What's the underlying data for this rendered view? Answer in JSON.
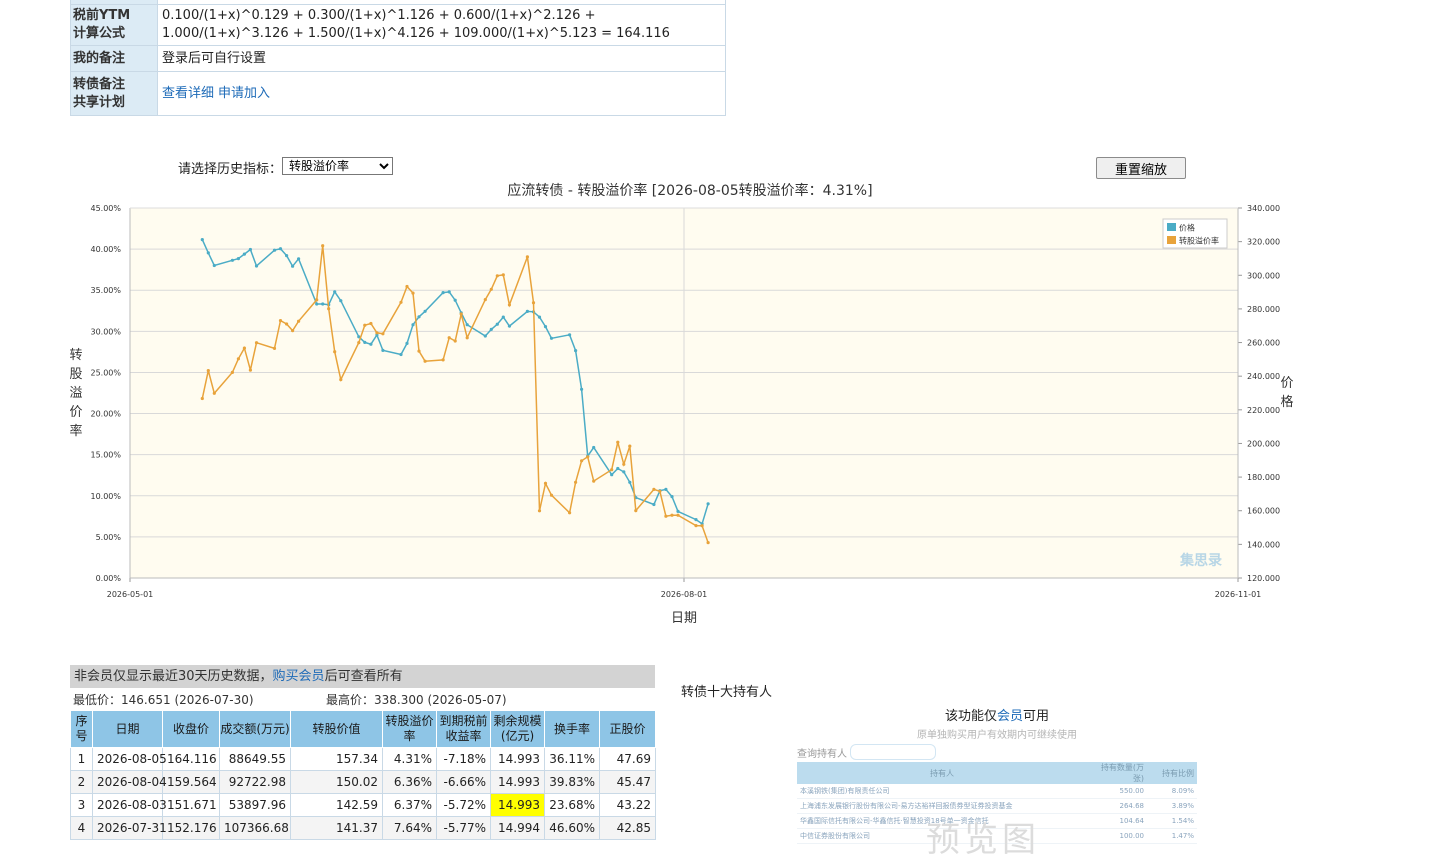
{
  "info": {
    "rows": [
      {
        "key_line1": "税前YTM",
        "key_line2": "计算公式",
        "value": "0.100/(1+x)^0.129 + 0.300/(1+x)^1.126 + 0.600/(1+x)^2.126 + 1.000/(1+x)^3.126 + 1.500/(1+x)^4.126 + 109.000/(1+x)^5.123 = 164.116"
      },
      {
        "key": "我的备注",
        "value": "登录后可自行设置"
      },
      {
        "key_line1": "转债备注",
        "key_line2": "共享计划",
        "link1": "查看详细",
        "link2": "申请加入"
      }
    ]
  },
  "controls": {
    "select_label": "请选择历史指标：",
    "select_value": "转股溢价率",
    "reset_label": "重置缩放"
  },
  "chart_data": {
    "type": "line",
    "title": "应流转债 - 转股溢价率 [2026-08-05转股溢价率：4.31%]",
    "xlabel": "日期",
    "ylabel_left": "转股溢价率",
    "ylabel_right": "价格",
    "x_range": [
      "2026-05-01",
      "2026-11-01"
    ],
    "x_ticks": [
      "2026-05-01",
      "2026-08-01",
      "2026-11-01"
    ],
    "y_left_range": [
      0,
      45
    ],
    "y_left_ticks": [
      "0.00%",
      "5.00%",
      "10.00%",
      "15.00%",
      "20.00%",
      "25.00%",
      "30.00%",
      "35.00%",
      "40.00%",
      "45.00%"
    ],
    "y_right_range": [
      120,
      340
    ],
    "y_right_ticks": [
      "120.000",
      "140.000",
      "160.000",
      "180.000",
      "200.000",
      "220.000",
      "240.000",
      "260.000",
      "280.000",
      "300.000",
      "320.000",
      "340.000"
    ],
    "grid": true,
    "legend_position": "top-right",
    "watermark": "集思录",
    "series": [
      {
        "name": "价格",
        "axis": "right",
        "color": "#4bacc6",
        "points": [
          [
            "2026-05-13",
            321.2
          ],
          [
            "2026-05-14",
            313.3
          ],
          [
            "2026-05-15",
            305.8
          ],
          [
            "2026-05-18",
            308.9
          ],
          [
            "2026-05-19",
            309.9
          ],
          [
            "2026-05-20",
            312.6
          ],
          [
            "2026-05-21",
            315.3
          ],
          [
            "2026-05-22",
            305.5
          ],
          [
            "2026-05-25",
            314.9
          ],
          [
            "2026-05-26",
            315.8
          ],
          [
            "2026-05-27",
            311.7
          ],
          [
            "2026-05-28",
            305.4
          ],
          [
            "2026-05-29",
            309.8
          ],
          [
            "2026-06-01",
            282.9
          ],
          [
            "2026-06-02",
            282.9
          ],
          [
            "2026-06-03",
            282.5
          ],
          [
            "2026-06-04",
            290.2
          ],
          [
            "2026-06-05",
            284.9
          ],
          [
            "2026-06-08",
            263.4
          ],
          [
            "2026-06-09",
            260.1
          ],
          [
            "2026-06-10",
            259.0
          ],
          [
            "2026-06-11",
            264.5
          ],
          [
            "2026-06-12",
            255.3
          ],
          [
            "2026-06-15",
            252.9
          ],
          [
            "2026-06-16",
            259.5
          ],
          [
            "2026-06-17",
            270.6
          ],
          [
            "2026-06-18",
            275.3
          ],
          [
            "2026-06-19",
            278.6
          ],
          [
            "2026-06-22",
            289.7
          ],
          [
            "2026-06-23",
            290.1
          ],
          [
            "2026-06-24",
            285.2
          ],
          [
            "2026-06-25",
            277.7
          ],
          [
            "2026-06-26",
            270.6
          ],
          [
            "2026-06-29",
            263.9
          ],
          [
            "2026-06-30",
            267.8
          ],
          [
            "2026-07-01",
            270.9
          ],
          [
            "2026-07-02",
            275.1
          ],
          [
            "2026-07-03",
            269.8
          ],
          [
            "2026-07-06",
            278.5
          ],
          [
            "2026-07-07",
            278.3
          ],
          [
            "2026-07-08",
            275.1
          ],
          [
            "2026-07-09",
            269.5
          ],
          [
            "2026-07-10",
            262.5
          ],
          [
            "2026-07-13",
            264.6
          ],
          [
            "2026-07-14",
            255.2
          ],
          [
            "2026-07-15",
            232.2
          ],
          [
            "2026-07-16",
            192.5
          ],
          [
            "2026-07-17",
            197.6
          ],
          [
            "2026-07-20",
            181.4
          ],
          [
            "2026-07-21",
            185.1
          ],
          [
            "2026-07-22",
            183.1
          ],
          [
            "2026-07-23",
            176.9
          ],
          [
            "2026-07-24",
            167.8
          ],
          [
            "2026-07-27",
            163.7
          ],
          [
            "2026-07-28",
            171.9
          ],
          [
            "2026-07-29",
            172.7
          ],
          [
            "2026-07-30",
            168.4
          ],
          [
            "2026-07-31",
            159.6
          ],
          [
            "2026-08-03",
            154.7
          ],
          [
            "2026-08-04",
            152.2
          ],
          [
            "2026-08-05",
            164.1
          ]
        ]
      },
      {
        "name": "转股溢价率",
        "axis": "left",
        "color": "#e8a33b",
        "points": [
          [
            "2026-05-13",
            21.83
          ],
          [
            "2026-05-14",
            25.23
          ],
          [
            "2026-05-15",
            22.46
          ],
          [
            "2026-05-18",
            25.01
          ],
          [
            "2026-05-19",
            26.66
          ],
          [
            "2026-05-20",
            27.96
          ],
          [
            "2026-05-21",
            25.29
          ],
          [
            "2026-05-22",
            28.62
          ],
          [
            "2026-05-25",
            27.92
          ],
          [
            "2026-05-26",
            31.3
          ],
          [
            "2026-05-27",
            30.89
          ],
          [
            "2026-05-28",
            30.09
          ],
          [
            "2026-05-29",
            31.23
          ],
          [
            "2026-06-01",
            33.82
          ],
          [
            "2026-06-02",
            40.42
          ],
          [
            "2026-06-03",
            32.75
          ],
          [
            "2026-06-04",
            27.52
          ],
          [
            "2026-06-05",
            24.13
          ],
          [
            "2026-06-08",
            28.63
          ],
          [
            "2026-06-09",
            30.75
          ],
          [
            "2026-06-10",
            30.95
          ],
          [
            "2026-06-11",
            29.82
          ],
          [
            "2026-06-12",
            29.7
          ],
          [
            "2026-06-15",
            33.53
          ],
          [
            "2026-06-16",
            35.45
          ],
          [
            "2026-06-17",
            34.65
          ],
          [
            "2026-06-18",
            27.59
          ],
          [
            "2026-06-19",
            26.37
          ],
          [
            "2026-06-22",
            26.52
          ],
          [
            "2026-06-23",
            29.23
          ],
          [
            "2026-06-24",
            28.83
          ],
          [
            "2026-06-25",
            32.11
          ],
          [
            "2026-06-26",
            29.22
          ],
          [
            "2026-06-29",
            33.86
          ],
          [
            "2026-06-30",
            35.11
          ],
          [
            "2026-07-01",
            36.75
          ],
          [
            "2026-07-02",
            36.86
          ],
          [
            "2026-07-03",
            33.22
          ],
          [
            "2026-07-06",
            39.05
          ],
          [
            "2026-07-07",
            33.48
          ],
          [
            "2026-07-08",
            8.17
          ],
          [
            "2026-07-09",
            11.5
          ],
          [
            "2026-07-10",
            10.07
          ],
          [
            "2026-07-13",
            7.93
          ],
          [
            "2026-07-14",
            11.64
          ],
          [
            "2026-07-15",
            14.25
          ],
          [
            "2026-07-16",
            14.74
          ],
          [
            "2026-07-17",
            11.79
          ],
          [
            "2026-07-20",
            13.17
          ],
          [
            "2026-07-21",
            16.52
          ],
          [
            "2026-07-22",
            13.83
          ],
          [
            "2026-07-23",
            16.04
          ],
          [
            "2026-07-24",
            8.2
          ],
          [
            "2026-07-27",
            10.78
          ],
          [
            "2026-07-28",
            10.54
          ],
          [
            "2026-07-29",
            7.52
          ],
          [
            "2026-07-30",
            7.64
          ],
          [
            "2026-07-31",
            7.64
          ],
          [
            "2026-08-03",
            6.37
          ],
          [
            "2026-08-04",
            6.36
          ],
          [
            "2026-08-05",
            4.31
          ]
        ]
      }
    ]
  },
  "history": {
    "notice_prefix": "非会员仅显示最近30天历史数据，",
    "notice_link": "购买会员",
    "notice_suffix": "后可查看所有",
    "low": "最低价：146.651 (2026-07-30)",
    "high": "最高价：338.300 (2026-05-07)",
    "headers": [
      "序号",
      "日期",
      "收盘价",
      "成交额(万元)",
      "转股价值",
      "转股溢价率",
      "到期税前收益率",
      "剩余规模(亿元)",
      "换手率",
      "正股价"
    ],
    "rows": [
      [
        "1",
        "2026-08-05",
        "164.116",
        "88649.55",
        "157.34",
        "4.31%",
        "-7.18%",
        "14.993",
        "36.11%",
        "47.69"
      ],
      [
        "2",
        "2026-08-04",
        "159.564",
        "92722.98",
        "150.02",
        "6.36%",
        "-6.66%",
        "14.993",
        "39.83%",
        "45.47"
      ],
      [
        "3",
        "2026-08-03",
        "151.671",
        "53897.96",
        "142.59",
        "6.37%",
        "-5.72%",
        "14.993",
        "23.68%",
        "43.22"
      ],
      [
        "4",
        "2026-07-31",
        "152.176",
        "107366.68",
        "141.37",
        "7.64%",
        "-5.77%",
        "14.994",
        "46.60%",
        "42.85"
      ]
    ]
  },
  "holders": {
    "title": "转债十大持有人",
    "locked_prefix": "该功能仅",
    "locked_link": "会员",
    "locked_suffix": "可用",
    "locked_sub": "原单独购买用户有效期内可继续使用",
    "query_label": "查询持有人",
    "preview_headers": [
      "持有人",
      "持有数量(万张)",
      "持有比例"
    ],
    "preview_rows": [
      [
        "本溪钢铁(集团)有限责任公司",
        "550.00",
        "8.09%"
      ],
      [
        "上海浦东发展银行股份有限公司-易方达裕祥回报债券型证券投资基金",
        "264.68",
        "3.89%"
      ],
      [
        "华鑫国际信托有限公司-华鑫信托·智慧投资18号单一资金信托",
        "104.64",
        "1.54%"
      ],
      [
        "中信证券股份有限公司",
        "100.00",
        "1.47%"
      ]
    ],
    "preview_watermark": "预览图"
  }
}
